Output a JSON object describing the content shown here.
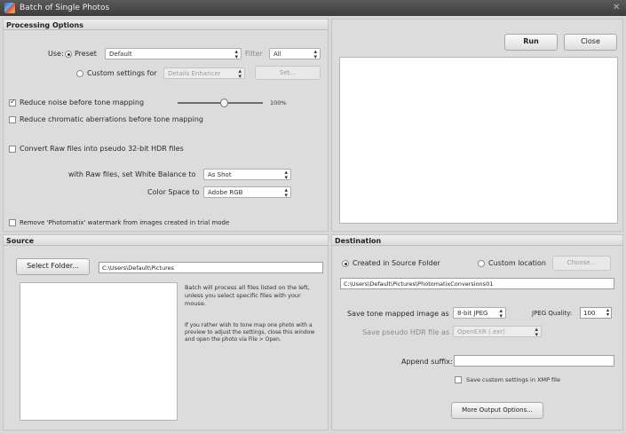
{
  "window": {
    "title": "Batch of Single Photos",
    "close_icon": "✕"
  },
  "processing": {
    "header": "Processing Options",
    "use_label": "Use:",
    "preset_label": "Preset",
    "preset_value": "Default",
    "filter_label": "Filter",
    "filter_value": "All",
    "custom_label": "Custom settings for",
    "custom_value": "Details Enhancer",
    "set_button": "Set...",
    "reduce_noise_label": "Reduce noise before tone mapping",
    "reduce_noise_checked": true,
    "reduce_noise_percent": "100%",
    "reduce_noise_level": 0.55,
    "reduce_ca_label": "Reduce chromatic aberrations before tone mapping",
    "convert_raw_label": "Convert Raw files into pseudo 32-bit HDR files",
    "white_balance_label": "with Raw files, set White Balance to",
    "white_balance_value": "As Shot",
    "color_space_label": "Color Space to",
    "color_space_value": "Adobe RGB",
    "watermark_label": "Remove 'Photomatix' watermark from images created in trial mode"
  },
  "actions": {
    "run": "Run",
    "close": "Close"
  },
  "source": {
    "header": "Source",
    "select_folder": "Select Folder...",
    "path": "C:\\Users\\Default\\Pictures",
    "info1": "Batch will process all files listed on the left, unless you select specific files with your mouse.",
    "info2": "If you rather wish to tone map one photo with a preview to adjust the settings, close this window and open the photo via File > Open."
  },
  "destination": {
    "header": "Destination",
    "created_in_source": "Created in Source Folder",
    "custom_location": "Custom location",
    "choose_button": "Choose...",
    "path": "C:\\Users\\Default\\Pictures\\PhotomatixConversions01",
    "save_tone_label": "Save tone mapped image as",
    "save_tone_value": "8-bit JPEG",
    "jpeg_quality_label": "JPEG Quality:",
    "jpeg_quality_value": "100",
    "save_hdr_label": "Save pseudo HDR file as",
    "save_hdr_value": "OpenEXR (.exr)",
    "append_suffix_label": "Append suffix:",
    "append_suffix_value": "",
    "xmp_label": "Save custom settings in XMP file",
    "more_output": "More Output Options..."
  }
}
